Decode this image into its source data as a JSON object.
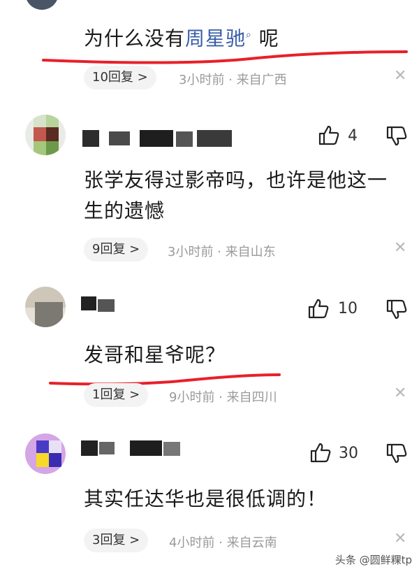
{
  "comments": [
    {
      "text_pre": "为什么没有",
      "link": "周星驰",
      "text_post": "呢",
      "reply": "10回复 >",
      "meta": "3小时前 · 来自广西"
    },
    {
      "text_line1": "张学友得过影帝吗，也许是他这一",
      "text_line2": "生的遗憾",
      "likes": "4",
      "reply": "9回复 >",
      "meta": "3小时前 · 来自山东"
    },
    {
      "text": "发哥和星爷呢？",
      "likes": "10",
      "reply": "1回复 >",
      "meta": "9小时前 · 来自四川"
    },
    {
      "text": "其实任达华也是很低调的！",
      "likes": "30",
      "reply": "3回复 >",
      "meta": "4小时前 · 来自云南"
    }
  ],
  "watermark": "头条 @圆鲜粿tp",
  "icons": {
    "like": "thumbs-up-icon",
    "dislike": "thumbs-down-icon",
    "close": "close-icon",
    "search": "search-icon"
  },
  "colors": {
    "underline": "#e8202a",
    "link": "#3a5fa8",
    "meta": "#9a9a9a"
  }
}
